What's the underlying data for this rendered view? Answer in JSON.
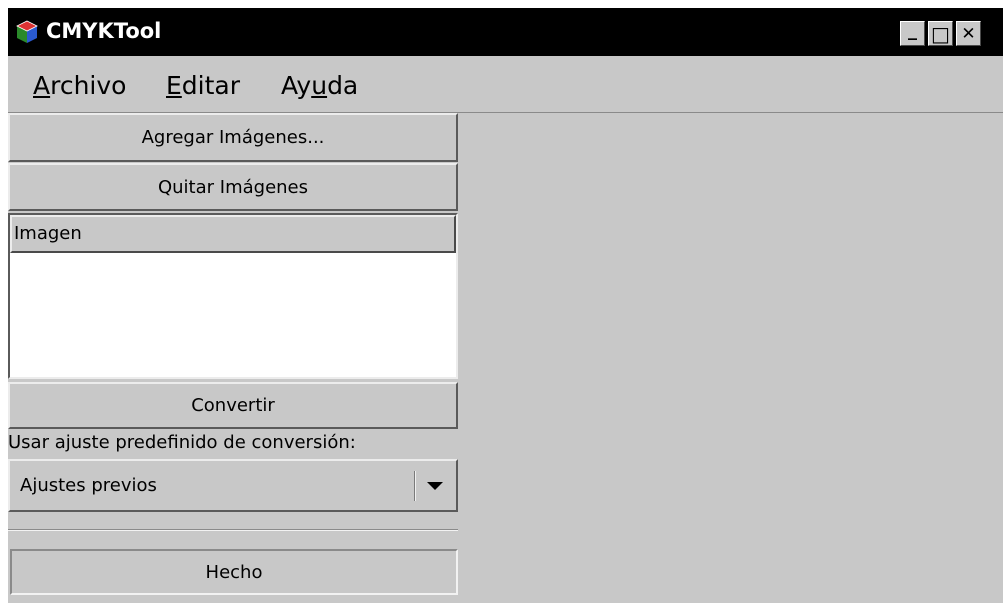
{
  "window": {
    "title": "CMYKTool",
    "controls": {
      "minimize": "_",
      "maximize": "□",
      "close": "✕"
    }
  },
  "menu": {
    "archivo": {
      "mnemonic": "A",
      "rest": "rchivo"
    },
    "editar": {
      "mnemonic": "E",
      "rest": "ditar"
    },
    "ayuda": {
      "pre": "Ay",
      "mnemonic": "u",
      "rest": "da"
    }
  },
  "panel": {
    "add_button": "Agregar Imágenes...",
    "remove_button": "Quitar Imágenes",
    "list_header": "Imagen",
    "convert_button": "Convertir",
    "preset_label": "Usar ajuste predefinido de conversión:",
    "preset_selected": "Ajustes previos",
    "status": "Hecho"
  },
  "colors": {
    "titlebar": "#000000",
    "background": "#c8c8c8",
    "list_bg": "#ffffff"
  }
}
